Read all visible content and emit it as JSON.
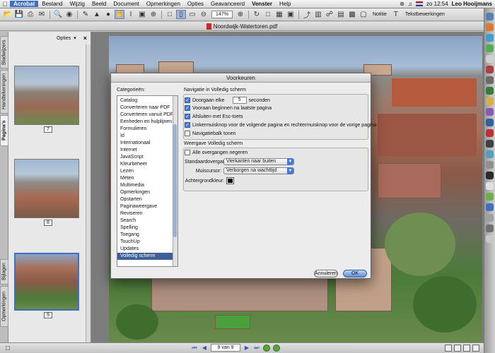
{
  "menubar": {
    "app": "Acrobat",
    "items": [
      "Bestand",
      "Wijzig",
      "Beeld",
      "Document",
      "Opmerkingen",
      "Opties",
      "Geavanceerd",
      "Venster",
      "Help"
    ],
    "clock": "zo 12:54",
    "user": "Leo Hooijmans"
  },
  "toolbar": {
    "zoom": "147%",
    "notitie": "Notitie",
    "tekstbewerkingen": "Tekstbewerkingen"
  },
  "document": {
    "title": "Noordwijk-Watertoren.pdf"
  },
  "navtabs": {
    "bladwijzers": "Bladwijzers",
    "handtekeningen": "Handtekeningen",
    "paginas": "Pagina's",
    "bijlagen": "Bijlagen",
    "opmerkingen": "Opmerkingen"
  },
  "thumbpanel": {
    "opties": "Opties",
    "pages": [
      "7",
      "8",
      "9"
    ]
  },
  "statusbar": {
    "page_field": "9 van 9"
  },
  "dialog": {
    "title": "Voorkeuren",
    "categories_label": "Categorieën:",
    "categories": [
      "Catalog",
      "Converteren naar PDF",
      "Converteren vanuit PDF",
      "Eenheden en hulplijnen",
      "Formulieren",
      "Id",
      "Internationaal",
      "Internet",
      "JavaScript",
      "Kleurbeheer",
      "Lezen",
      "Meten",
      "Multimedia",
      "Opmerkingen",
      "Opstarten",
      "Paginaweergave",
      "Reviseren",
      "Search",
      "Spelling",
      "Toegang",
      "TouchUp",
      "Updates",
      "Volledig scherm"
    ],
    "selected_category": "Volledig scherm",
    "nav_group": {
      "title": "Navigatie in Volledig scherm",
      "doorgaan_prefix": "Doorgaan elke",
      "doorgaan_value": "5",
      "doorgaan_suffix": "seconden",
      "vooraan": "Vooraan beginnen na laatste pagina",
      "afsluiten": "Afsluiten met Esc-toets",
      "linkermuisknop": "Linkermuisknop voor de volgende pagina en rechtermuisknop voor de vorige pagina",
      "navigatiebalk": "Navigatiebalk tonen"
    },
    "view_group": {
      "title": "Weergave Volledig scherm",
      "alle_overgangen": "Alle overgangen negeren",
      "standaard_label": "Standaardovergang:",
      "standaard_value": "Vierkanten naar buiten",
      "muiscursor_label": "Muiscursor:",
      "muiscursor_value": "Verborgen na wachttijd",
      "achtergrond_label": "Achtergrondkleur:"
    },
    "buttons": {
      "cancel": "Annuleren",
      "ok": "OK"
    },
    "colors": {
      "accent": "#4b7bd0",
      "selection": "#3d5f9a",
      "background_color": "#000000"
    }
  }
}
